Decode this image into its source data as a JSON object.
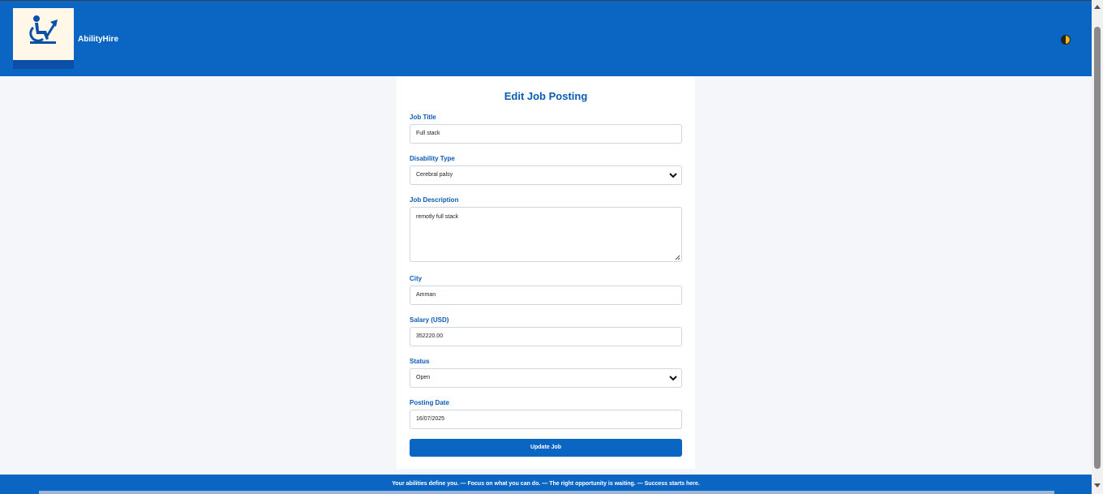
{
  "header": {
    "brand": "AbilityHire",
    "logo_icon": "wheelchair-arrow-icon",
    "contrast_icon": "contrast-toggle-icon"
  },
  "form": {
    "title": "Edit Job Posting",
    "job_title": {
      "label": "Job Title",
      "value": "Full stack"
    },
    "disability_type": {
      "label": "Disability Type",
      "value": "Cerebral palsy"
    },
    "job_description": {
      "label": "Job Description",
      "value": "remotly  full stack"
    },
    "city": {
      "label": "City",
      "value": "Amman"
    },
    "salary": {
      "label": "Salary (USD)",
      "value": "352220.00"
    },
    "status": {
      "label": "Status",
      "value": "Open"
    },
    "posting_date": {
      "label": "Posting Date",
      "value": "16/07/2025"
    },
    "submit_label": "Update Job"
  },
  "footer": {
    "text": "Your abilities define you. — Focus on what you can do. — The right opportunity is waiting. — Success starts here."
  },
  "colors": {
    "primary": "#0b66c3",
    "heading": "#0b5bb5",
    "logo_bg": "#fff7e8"
  }
}
